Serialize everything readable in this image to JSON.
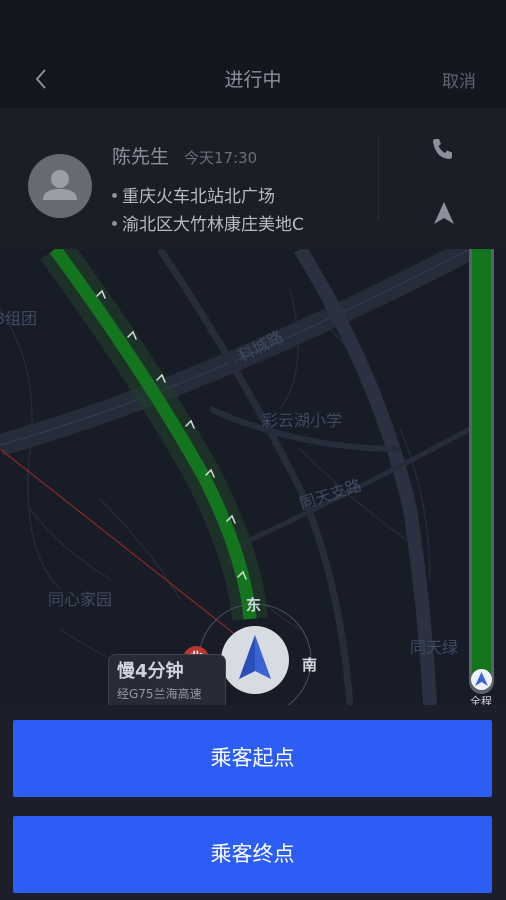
{
  "nav": {
    "title": "进行中",
    "cancel_label": "取消"
  },
  "passenger": {
    "name": "陈先生",
    "time": "今天17:30",
    "start_address": "重庆火车北站北广场",
    "end_address": "渝北区大竹林康庄美地C"
  },
  "map": {
    "labels": {
      "poi_left": "B组团",
      "road_kecheng": "科城路",
      "school": "彩云湖小学",
      "road_tongtianzhi": "同天支路",
      "poi_tongxin": "同心家园",
      "road_tongtian": "同天绿"
    },
    "compass": {
      "east": "东",
      "south": "南",
      "north_badge": "北"
    },
    "eta": {
      "main": "慢4分钟",
      "sub": "经G75兰海高速"
    },
    "progress": {
      "fraction": 0.97,
      "label": "全程"
    },
    "colors": {
      "route_green": "#14751f",
      "progress_green": "#14751f",
      "vehicle_blue": "#3a63d6"
    }
  },
  "actions": {
    "pickup_label": "乘客起点",
    "dropoff_label": "乘客终点",
    "button_color": "#2c5ef5"
  },
  "icons": {
    "back": "chevron-left-icon",
    "phone": "phone-icon",
    "navigate": "navigation-arrow-icon",
    "vehicle": "vehicle-arrow-icon",
    "avatar": "person-icon"
  }
}
